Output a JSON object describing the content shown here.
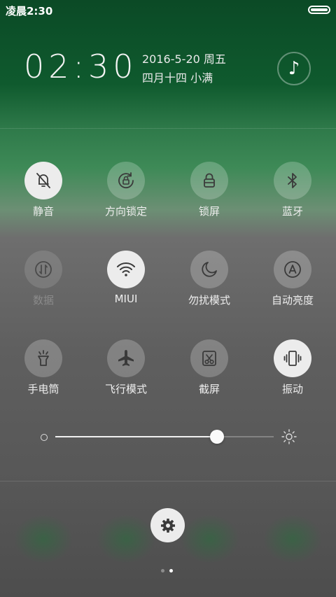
{
  "status_bar": {
    "time": "凌晨2:30",
    "battery_icon": "battery-full-icon"
  },
  "header": {
    "clock": "02:30",
    "date": "2016-5-20 周五",
    "lunar": "四月十四 小满",
    "music_icon": "music-note-icon"
  },
  "toggles": [
    {
      "label": "静音",
      "icon": "bell-off-icon",
      "state": "on"
    },
    {
      "label": "方向锁定",
      "icon": "rotation-lock-icon",
      "state": "off"
    },
    {
      "label": "锁屏",
      "icon": "lock-icon",
      "state": "off"
    },
    {
      "label": "蓝牙",
      "icon": "bluetooth-icon",
      "state": "off"
    },
    {
      "label": "数据",
      "icon": "mobile-data-icon",
      "state": "disabled"
    },
    {
      "label": "MIUI",
      "icon": "wifi-icon",
      "state": "on"
    },
    {
      "label": "勿扰模式",
      "icon": "moon-icon",
      "state": "off"
    },
    {
      "label": "自动亮度",
      "icon": "auto-brightness-icon",
      "state": "off"
    },
    {
      "label": "手电筒",
      "icon": "flashlight-icon",
      "state": "off"
    },
    {
      "label": "飞行模式",
      "icon": "airplane-icon",
      "state": "off"
    },
    {
      "label": "截屏",
      "icon": "screenshot-icon",
      "state": "off"
    },
    {
      "label": "振动",
      "icon": "vibrate-icon",
      "state": "on"
    }
  ],
  "brightness": {
    "level": 0.74,
    "min_icon": "brightness-low-icon",
    "max_icon": "brightness-high-icon"
  },
  "settings": {
    "icon": "gear-icon"
  },
  "pager": {
    "page_count": 2,
    "current_page": 2
  },
  "colors": {
    "header_green": "#0f5a2e",
    "toggle_on": "#ececec",
    "icon_dark": "#3a3a3a"
  }
}
